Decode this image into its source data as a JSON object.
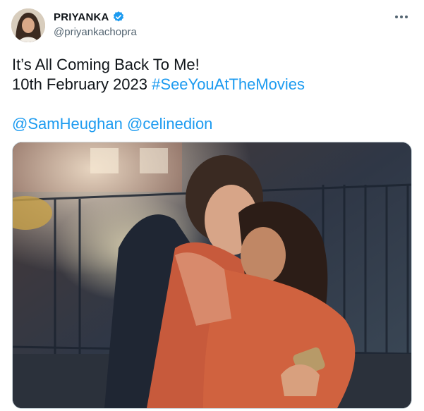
{
  "author": {
    "name": "PRIYANKA",
    "handle": "@priyankachopra",
    "verified": true
  },
  "tweet": {
    "line1": "It’s All Coming Back To Me!",
    "date": "10th February 2023",
    "hashtag": "#SeeYouAtTheMovies",
    "mention1": "@SamHeughan",
    "mention2": "@celinedion"
  },
  "colors": {
    "link": "#1d9bf0",
    "verified": "#1d9bf0"
  },
  "icons": {
    "verified": "verified-badge-icon",
    "more": "more-options-icon"
  }
}
